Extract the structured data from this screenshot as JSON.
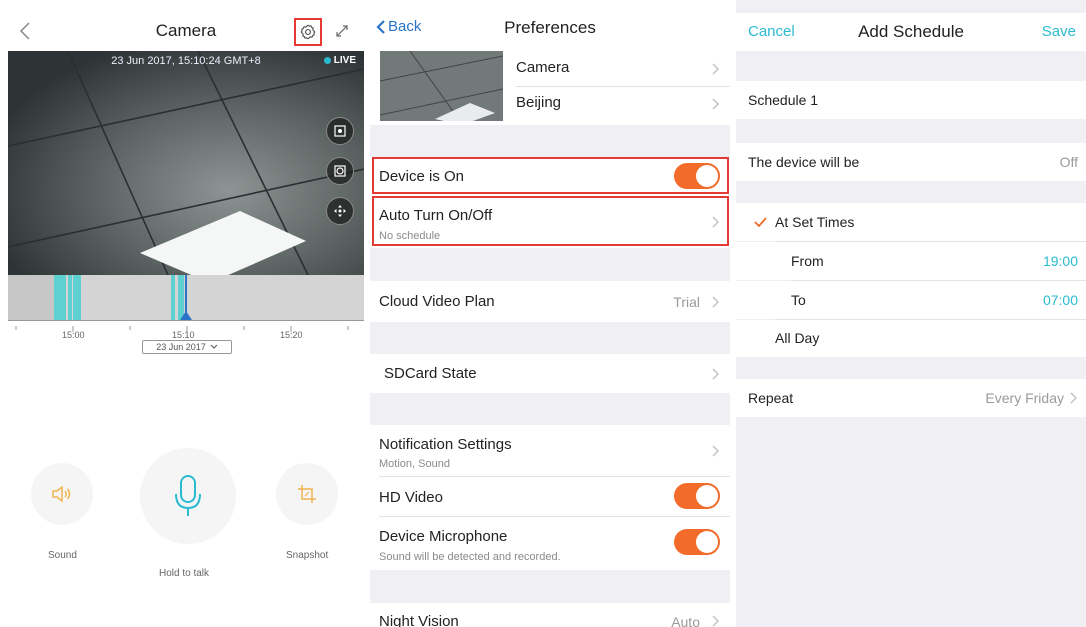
{
  "camera": {
    "title": "Camera",
    "timestamp": "23 Jun 2017, 15:10:24 GMT+8",
    "live_label": "LIVE",
    "timeline": {
      "ticks": [
        "15:00",
        "15:10",
        "15:20"
      ],
      "date": "23 Jun 2017"
    },
    "controls": {
      "sound": "Sound",
      "talk": "Hold to talk",
      "snapshot": "Snapshot"
    }
  },
  "preferences": {
    "back_label": "Back",
    "title": "Preferences",
    "camera_name": "Camera",
    "location": "Beijing",
    "device_on": {
      "label": "Device is On",
      "enabled": true
    },
    "auto_turn": {
      "label": "Auto Turn On/Off",
      "sub": "No schedule"
    },
    "cloud": {
      "label": "Cloud Video Plan",
      "value": "Trial"
    },
    "sdcard": {
      "label": "SDCard State"
    },
    "notifications": {
      "label": "Notification Settings",
      "sub": "Motion, Sound"
    },
    "hd_video": {
      "label": "HD Video",
      "enabled": true
    },
    "microphone": {
      "label": "Device Microphone",
      "sub": "Sound will be detected and recorded.",
      "enabled": true
    },
    "night_vision": {
      "label": "Night Vision",
      "value": "Auto"
    }
  },
  "schedule": {
    "cancel_label": "Cancel",
    "title": "Add Schedule",
    "save_label": "Save",
    "name": "Schedule 1",
    "device_will_be": {
      "label": "The device will be",
      "value": "Off"
    },
    "at_set_times": "At Set Times",
    "from": {
      "label": "From",
      "value": "19:00"
    },
    "to": {
      "label": "To",
      "value": "07:00"
    },
    "all_day": "All Day",
    "repeat": {
      "label": "Repeat",
      "value": "Every Friday"
    }
  },
  "colors": {
    "accent": "#2bbbd0",
    "toggle_on": "#f26b2a",
    "highlight": "#e53935",
    "ios_blue": "#2a73c6",
    "group_gray": "#efeff4"
  },
  "icons": {
    "back": "chevron-left-icon",
    "settings": "gear-icon",
    "expand": "expand-icon",
    "record": "record-icon",
    "capture": "capture-icon",
    "ptz": "ptz-icon",
    "sound": "speaker-icon",
    "talk": "microphone-icon",
    "snapshot": "crop-icon",
    "disclosure": "chevron-right-icon",
    "selected": "checkmark-icon"
  }
}
